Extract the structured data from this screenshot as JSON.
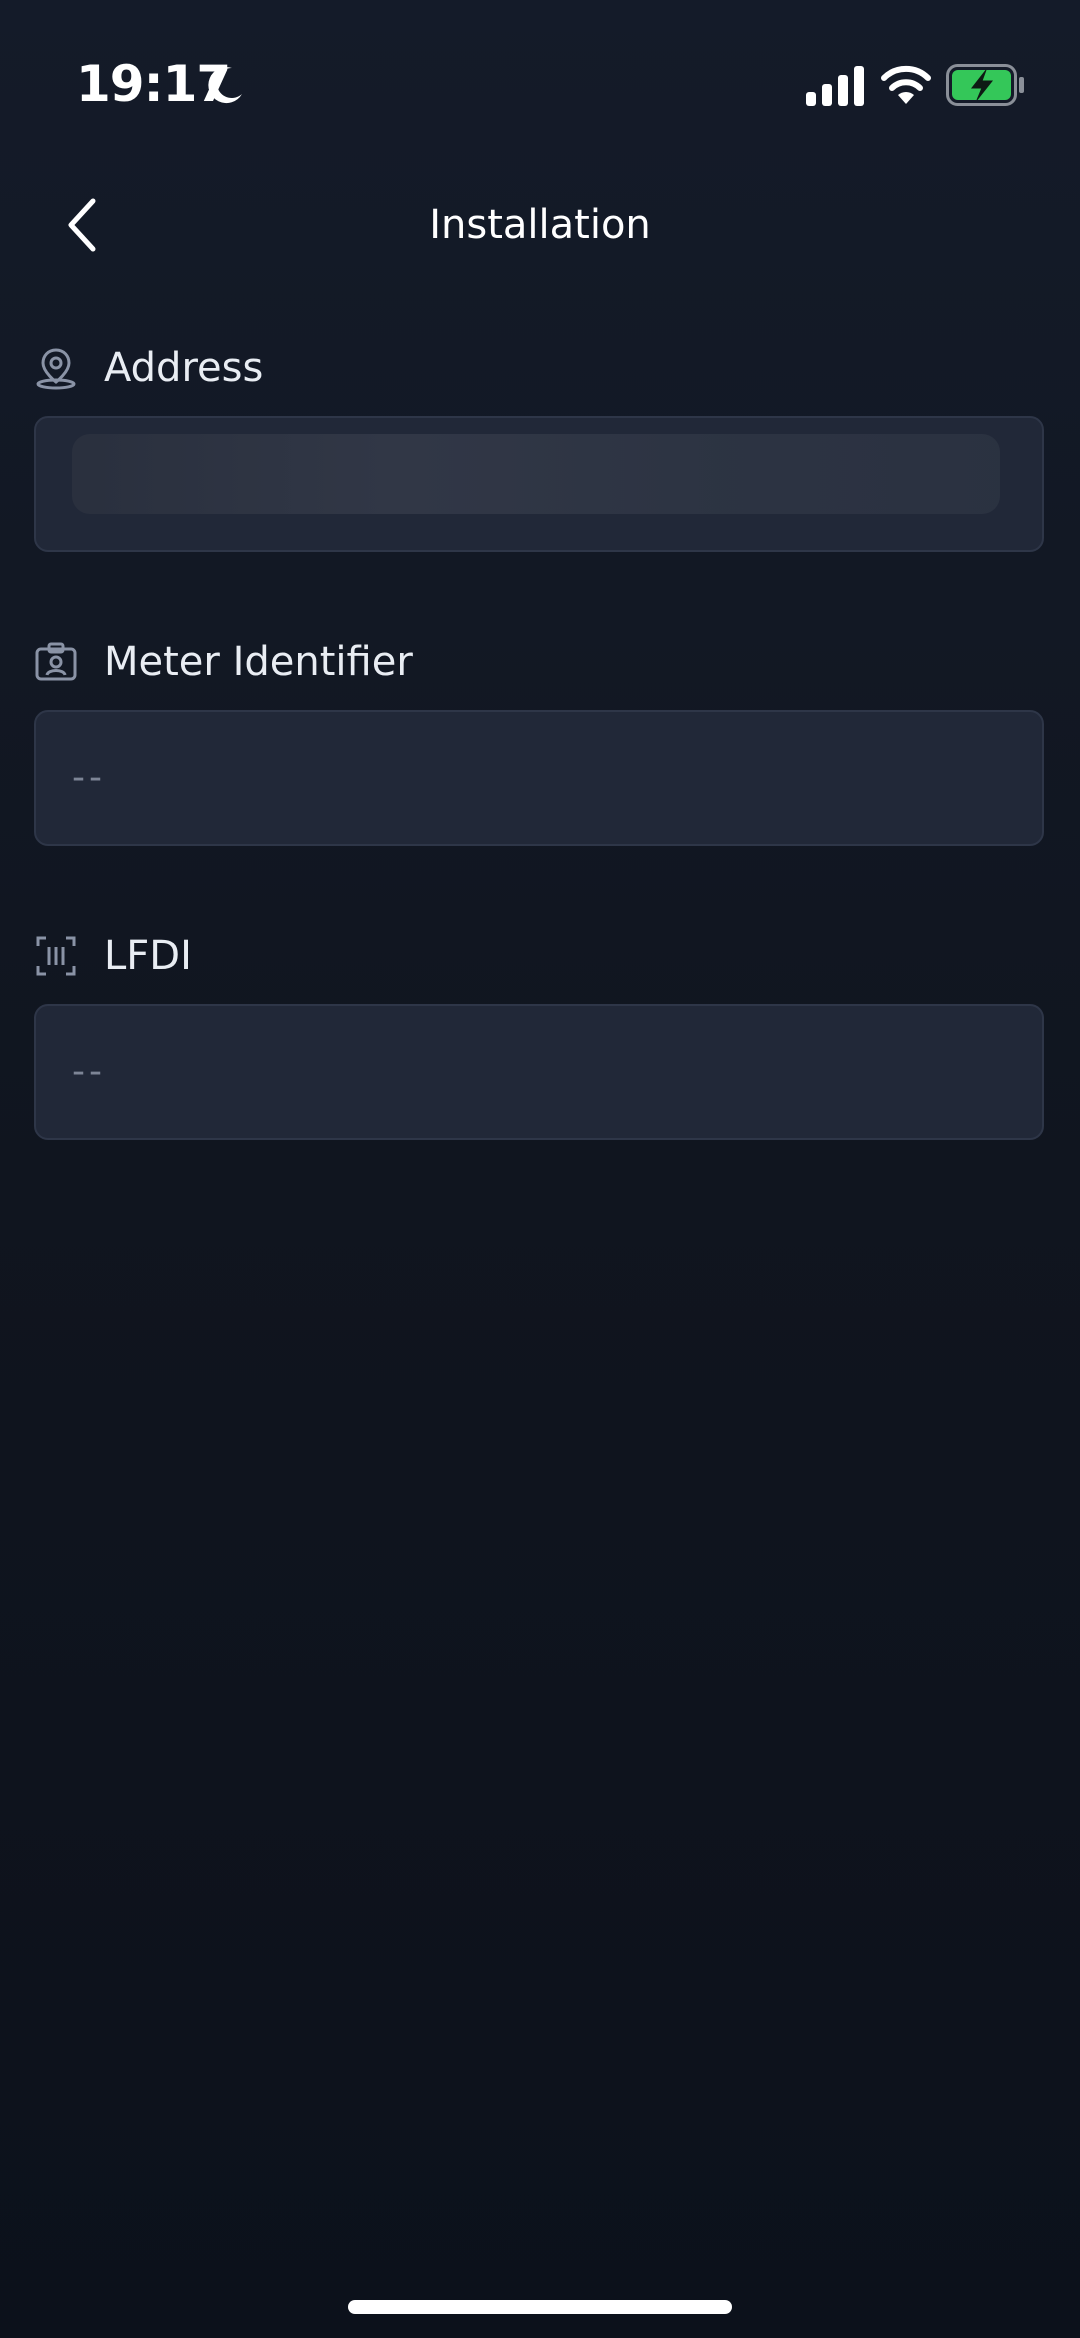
{
  "status_bar": {
    "time": "19:17",
    "icons": [
      "moon-icon",
      "signal-icon",
      "wifi-icon",
      "battery-charging-icon"
    ],
    "battery_color": "#34c759"
  },
  "header": {
    "title": "Installation",
    "back_icon": "chevron-left-icon"
  },
  "fields": {
    "address": {
      "label": "Address",
      "icon": "location-pin-icon",
      "value": ""
    },
    "meter_identifier": {
      "label": "Meter Identifier",
      "icon": "id-badge-icon",
      "value": "--"
    },
    "lfdi": {
      "label": "LFDI",
      "icon": "barcode-scan-icon",
      "value": "--"
    }
  },
  "colors": {
    "background": "#111722",
    "field_background": "#212838",
    "field_border": "#2e3648",
    "placeholder_text": "#7d8596"
  }
}
